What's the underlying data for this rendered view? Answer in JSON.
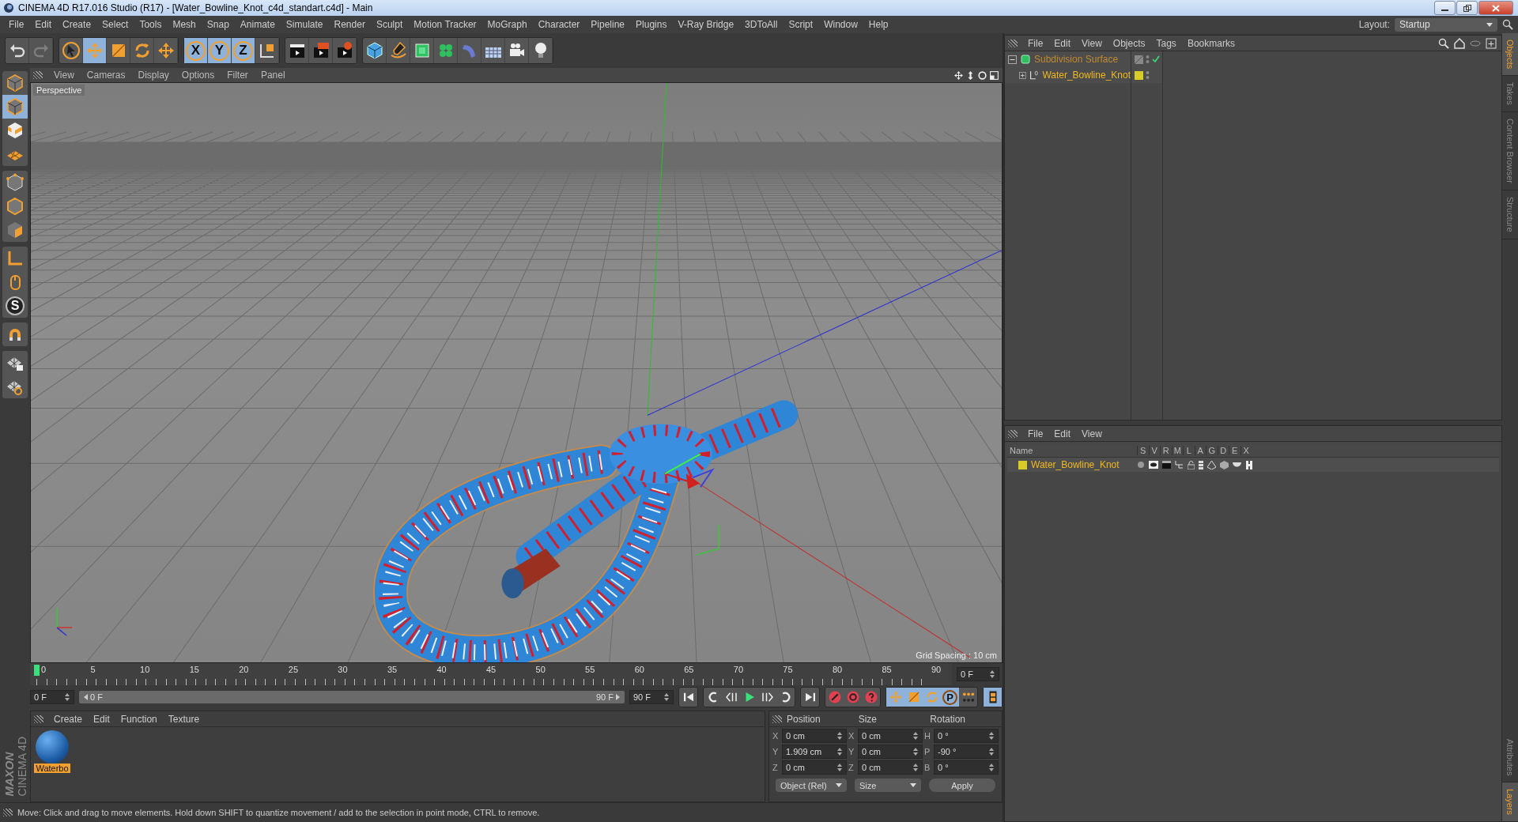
{
  "window": {
    "title": "CINEMA 4D R17.016 Studio (R17) - [Water_Bowline_Knot_c4d_standart.c4d] - Main"
  },
  "menu_bar": [
    "File",
    "Edit",
    "Create",
    "Select",
    "Tools",
    "Mesh",
    "Snap",
    "Animate",
    "Simulate",
    "Render",
    "Sculpt",
    "Motion Tracker",
    "MoGraph",
    "Character",
    "Pipeline",
    "Plugins",
    "V-Ray Bridge",
    "3DToAll",
    "Script",
    "Window",
    "Help"
  ],
  "layout": {
    "label": "Layout:",
    "value": "Startup"
  },
  "toolbar": [
    [
      {
        "kind": "undo",
        "selected": false,
        "disabled": false
      },
      {
        "kind": "redo",
        "selected": false,
        "disabled": true
      }
    ],
    [
      {
        "kind": "select",
        "selected": false,
        "disabled": false
      },
      {
        "kind": "move",
        "selected": true,
        "disabled": false
      },
      {
        "kind": "scale",
        "selected": false,
        "disabled": false
      },
      {
        "kind": "rotate",
        "selected": false,
        "disabled": false
      },
      {
        "kind": "transform",
        "selected": false,
        "disabled": false
      }
    ],
    [
      {
        "kind": "axis",
        "label": "X",
        "selected": true,
        "disabled": false
      },
      {
        "kind": "axis",
        "label": "Y",
        "selected": true,
        "disabled": false
      },
      {
        "kind": "axis",
        "label": "Z",
        "selected": true,
        "disabled": false
      },
      {
        "kind": "coords",
        "selected": false,
        "disabled": false
      }
    ],
    [
      {
        "kind": "render_view",
        "selected": false,
        "disabled": false
      },
      {
        "kind": "render_picture",
        "selected": false,
        "disabled": false
      },
      {
        "kind": "render_settings",
        "selected": false,
        "disabled": false
      }
    ],
    [
      {
        "kind": "cube",
        "selected": false,
        "disabled": false
      },
      {
        "kind": "pen",
        "selected": false,
        "disabled": false
      },
      {
        "kind": "subdivision",
        "selected": false,
        "disabled": false
      },
      {
        "kind": "cloner",
        "selected": false,
        "disabled": false
      },
      {
        "kind": "deformer",
        "selected": false,
        "disabled": false
      },
      {
        "kind": "floor",
        "selected": false,
        "disabled": false
      },
      {
        "kind": "camera",
        "selected": false,
        "disabled": false
      },
      {
        "kind": "light",
        "selected": false,
        "disabled": false
      }
    ]
  ],
  "left_toolbar": [
    [
      {
        "kind": "model",
        "selected": false
      },
      {
        "kind": "model",
        "selected": true
      },
      {
        "kind": "texture",
        "selected": false
      },
      {
        "kind": "workplane",
        "selected": false
      }
    ],
    [
      {
        "kind": "points",
        "selected": false
      },
      {
        "kind": "edges",
        "selected": false
      },
      {
        "kind": "polygons",
        "selected": false
      }
    ],
    [
      {
        "kind": "axis_mode",
        "selected": false
      },
      {
        "kind": "tweak",
        "selected": false
      },
      {
        "kind": "snap",
        "label": "S",
        "selected": false
      }
    ],
    [
      {
        "kind": "magnet",
        "selected": false
      }
    ],
    [
      {
        "kind": "grid_lock",
        "selected": false
      },
      {
        "kind": "grid_cycle",
        "selected": false
      }
    ]
  ],
  "viewport": {
    "menu": [
      "View",
      "Cameras",
      "Display",
      "Options",
      "Filter",
      "Panel"
    ],
    "camera": "Perspective",
    "grid_spacing": "Grid Spacing : 10 cm"
  },
  "timeline": {
    "ticks": [
      "0",
      "5",
      "10",
      "15",
      "20",
      "25",
      "30",
      "35",
      "40",
      "45",
      "50",
      "55",
      "60",
      "65",
      "70",
      "75",
      "80",
      "85",
      "90"
    ],
    "level": 0,
    "current_frame": "0 F",
    "start": "0 F",
    "range": {
      "start": "0 F",
      "end": "90 F",
      "level": 1
    },
    "end": "90 F"
  },
  "playback": [
    [
      {
        "kind": "goto_start",
        "selected": false
      }
    ],
    [
      {
        "kind": "loop_back",
        "selected": false
      },
      {
        "kind": "prev_key",
        "selected": false
      },
      {
        "kind": "play",
        "selected": false
      },
      {
        "kind": "next_key",
        "selected": false
      },
      {
        "kind": "loop",
        "selected": false
      }
    ],
    [
      {
        "kind": "goto_end",
        "selected": false
      }
    ],
    [
      {
        "kind": "record",
        "selected": false
      },
      {
        "kind": "autokey",
        "selected": false
      },
      {
        "kind": "keyframe",
        "selected": false
      }
    ],
    [
      {
        "kind": "move",
        "selected": true
      },
      {
        "kind": "scale",
        "selected": true
      },
      {
        "kind": "rotate",
        "selected": true
      },
      {
        "kind": "param",
        "label": "P",
        "selected": true
      },
      {
        "kind": "dots",
        "selected": false
      }
    ],
    [
      {
        "kind": "film",
        "selected": true
      }
    ]
  ],
  "material_manager": {
    "menu": [
      "Create",
      "Edit",
      "Function",
      "Texture"
    ],
    "materials": [
      {
        "name": "Waterbo",
        "selected": true
      }
    ]
  },
  "coordinates": {
    "headers": [
      "Position",
      "Size",
      "Rotation"
    ],
    "rows": [
      [
        {
          "axis": "X",
          "value": "0 cm"
        },
        {
          "axis": "X",
          "value": "0 cm"
        },
        {
          "axis": "H",
          "value": "0 °"
        }
      ],
      [
        {
          "axis": "Y",
          "value": "1.909 cm"
        },
        {
          "axis": "Y",
          "value": "0 cm"
        },
        {
          "axis": "P",
          "value": "-90 °"
        }
      ],
      [
        {
          "axis": "Z",
          "value": "0 cm"
        },
        {
          "axis": "Z",
          "value": "0 cm"
        },
        {
          "axis": "B",
          "value": "0 °"
        }
      ]
    ],
    "mode": "Object (Rel)",
    "size_mode": "Size",
    "apply": "Apply"
  },
  "branding": {
    "line1": "MAXON",
    "line2": "CINEMA 4D"
  },
  "status_bar": "Move: Click and drag to move elements. Hold down SHIFT to quantize movement / add to the selection in point mode, CTRL to remove.",
  "object_manager": {
    "menu": [
      "File",
      "Edit",
      "View",
      "Objects",
      "Tags",
      "Bookmarks"
    ],
    "objects": [
      {
        "name": "Subdivision Surface",
        "kind": "generator",
        "expanded": true,
        "enabled": true,
        "children": [
          {
            "name": "Water_Bowline_Knot",
            "kind": "null",
            "expanded": false,
            "color": "#d8cc28"
          }
        ]
      }
    ]
  },
  "side_tabs": [
    {
      "label": "Objects",
      "selected": true
    },
    {
      "label": "Takes",
      "selected": false
    },
    {
      "label": "Content Browser",
      "selected": false
    },
    {
      "label": "Structure",
      "selected": false
    }
  ],
  "layer_manager": {
    "menu": [
      "File",
      "Edit",
      "View"
    ],
    "columns": [
      "Name",
      "S",
      "V",
      "R",
      "M",
      "L",
      "A",
      "G",
      "D",
      "E",
      "X"
    ],
    "layers": [
      {
        "name": "Water_Bowline_Knot",
        "color": "#d8cc28"
      }
    ]
  },
  "lower_side_tabs": [
    {
      "label": "Attributes",
      "selected": false
    },
    {
      "label": "Layers",
      "selected": true
    }
  ]
}
